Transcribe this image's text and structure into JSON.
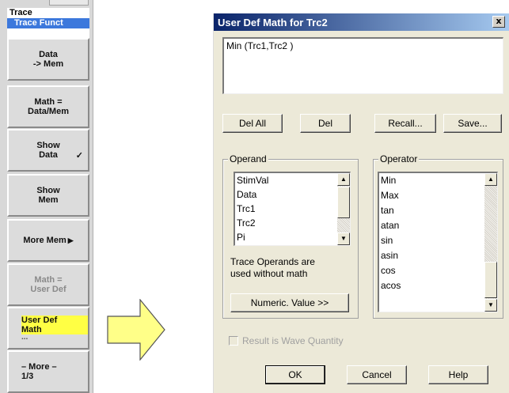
{
  "softkey_panel": {
    "title": "Trace",
    "subtitle": "Trace Funct",
    "keys": [
      {
        "line1": "Data",
        "line2": "-> Mem"
      },
      {
        "line1": "Math =",
        "line2": "Data/Mem"
      },
      {
        "line1": "Show",
        "line2": "Data",
        "check": "✓"
      },
      {
        "line1": "Show",
        "line2": "Mem"
      },
      {
        "line1": "More Mem",
        "line2": "",
        "arrow": "▶"
      },
      {
        "line1": "Math =",
        "line2": "User Def"
      },
      {
        "line1": "User Def",
        "line2": "Math",
        "dots": "..."
      },
      {
        "line1": "– More –",
        "line2": "1/3"
      }
    ]
  },
  "dialog": {
    "title": "User Def Math for Trc2",
    "close_glyph": "x",
    "expression": "Min (Trc1,Trc2 )",
    "buttons": {
      "del_all": "Del All",
      "del": "Del",
      "recall": "Recall...",
      "save": "Save..."
    },
    "operand": {
      "label": "Operand",
      "items": [
        "StimVal",
        "Data",
        "Trc1",
        "Trc2",
        "Pi"
      ],
      "hint_line1": "Trace Operands are",
      "hint_line2": "used without math",
      "numeric_button": "Numeric. Value >>"
    },
    "operator": {
      "label": "Operator",
      "items": [
        "Min",
        "Max",
        "tan",
        "atan",
        "sin",
        "asin",
        "cos",
        "acos"
      ]
    },
    "result_checkbox": "Result is Wave Quantity",
    "ok": "OK",
    "cancel": "Cancel",
    "help": "Help"
  },
  "colors": {
    "title_gradient_start": "#0a246a",
    "highlight": "#ffff44",
    "arrow_fill": "#ffff88"
  },
  "icons": {
    "scroll_up": "▲",
    "scroll_down": "▼"
  }
}
